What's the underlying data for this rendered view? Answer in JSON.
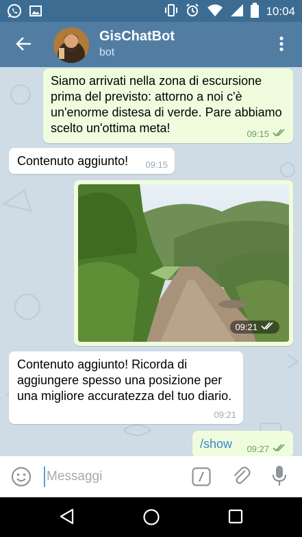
{
  "status_bar": {
    "time": "10:04",
    "left_icons": [
      "whatsapp-icon",
      "image-icon"
    ],
    "right_icons": [
      "vibrate-icon",
      "alarm-icon",
      "wifi-icon",
      "signal-icon",
      "battery-icon"
    ]
  },
  "header": {
    "title": "GisChatBot",
    "subtitle": "bot"
  },
  "messages": [
    {
      "direction": "out",
      "text": "Siamo arrivati nella zona di escursione prima del previsto: attorno a noi c'è un'enorme distesa di verde. Pare abbiamo scelto un'ottima meta!",
      "time": "09:15",
      "status": "read"
    },
    {
      "direction": "in",
      "text": "Contenuto aggiunto!",
      "time": "09:15"
    },
    {
      "direction": "out",
      "type": "photo",
      "time": "09:21",
      "status": "read"
    },
    {
      "direction": "in",
      "text": "Contenuto aggiunto! Ricorda di aggiungere spesso una posizione per una migliore accuratezza del tuo diario.",
      "time": "09:21"
    },
    {
      "direction": "out",
      "text": "/show",
      "time": "09:27",
      "status": "read"
    }
  ],
  "input": {
    "placeholder": "Messaggi"
  },
  "colors": {
    "header": "#517da2",
    "status_bar": "#3c6c92",
    "outgoing_bubble": "#effdde",
    "incoming_bubble": "#ffffff",
    "chat_background": "#cfdce6",
    "link": "#3a86c6"
  }
}
